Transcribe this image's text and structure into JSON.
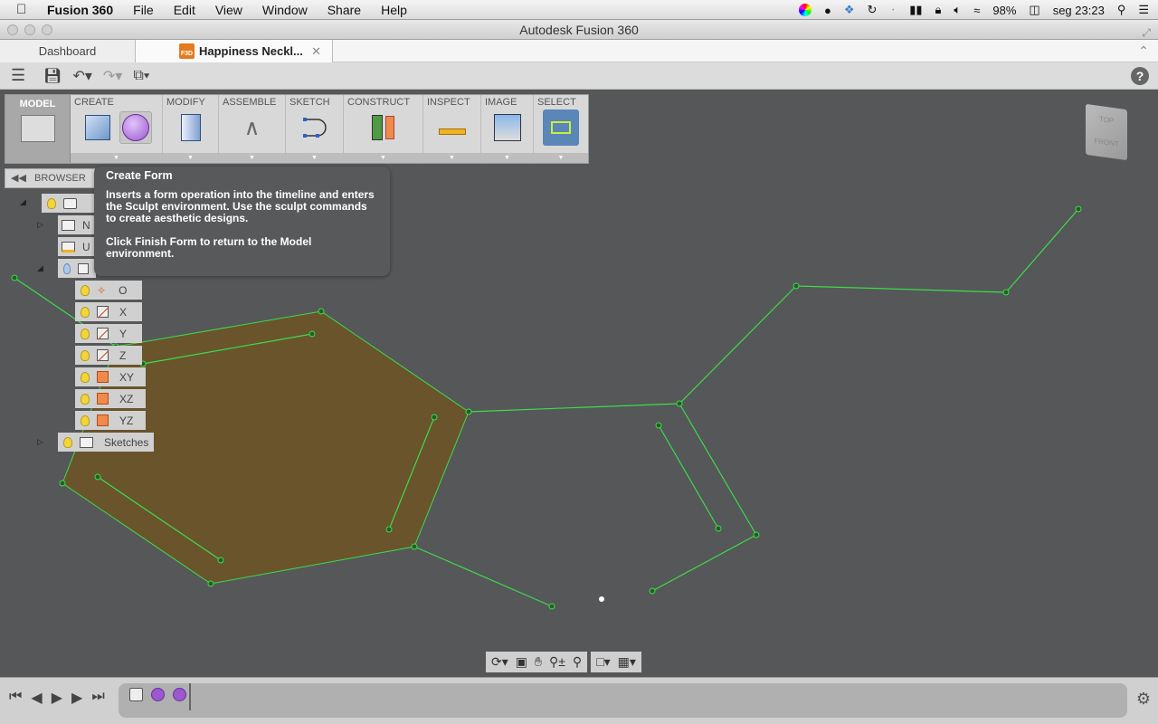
{
  "menubar": {
    "app": "Fusion 360",
    "items": [
      "File",
      "Edit",
      "View",
      "Window",
      "Share",
      "Help"
    ],
    "battery": "98%",
    "clock": "seg 23:23",
    "tray_icons": [
      "color-wheel-icon",
      "evernote-icon",
      "dropbox-icon",
      "time-machine-icon",
      "bluetooth-icon",
      "battery-meter-icon",
      "lock-icon",
      "volume-icon",
      "wifi-icon",
      "battery-icon",
      "spotlight-icon",
      "list-icon"
    ]
  },
  "window": {
    "title": "Autodesk Fusion 360"
  },
  "tabs": [
    {
      "label": "Dashboard"
    },
    {
      "label": "Happiness Neckl...",
      "icon_text": "F3D"
    }
  ],
  "ribbon": {
    "workspace": "MODEL",
    "groups": [
      {
        "label": "CREATE"
      },
      {
        "label": "MODIFY"
      },
      {
        "label": "ASSEMBLE"
      },
      {
        "label": "SKETCH"
      },
      {
        "label": "CONSTRUCT"
      },
      {
        "label": "INSPECT"
      },
      {
        "label": "IMAGE"
      },
      {
        "label": "SELECT"
      }
    ]
  },
  "browser": {
    "label": "BROWSER",
    "items": [
      {
        "label": "N"
      },
      {
        "label": "U"
      },
      {
        "label": "O"
      },
      {
        "label": "X"
      },
      {
        "label": "Y"
      },
      {
        "label": "Z"
      },
      {
        "label": "XY"
      },
      {
        "label": "XZ"
      },
      {
        "label": "YZ"
      },
      {
        "label": "Sketches"
      }
    ]
  },
  "tooltip": {
    "title": "Create Form",
    "p1": "Inserts a form operation into the timeline and enters the Sculpt environment. Use the sculpt commands to create aesthetic designs.",
    "p2": "Click Finish Form to return to the Model environment."
  },
  "viewcube": {
    "top": "TOP",
    "front": "FRONT"
  },
  "help": "?",
  "colors": {
    "viewport": "#555759",
    "sketch_line": "#3ddc4a",
    "profile_fill": "#6b5426",
    "sculpt": "#9b59d0",
    "accent": "#e67a1e"
  }
}
